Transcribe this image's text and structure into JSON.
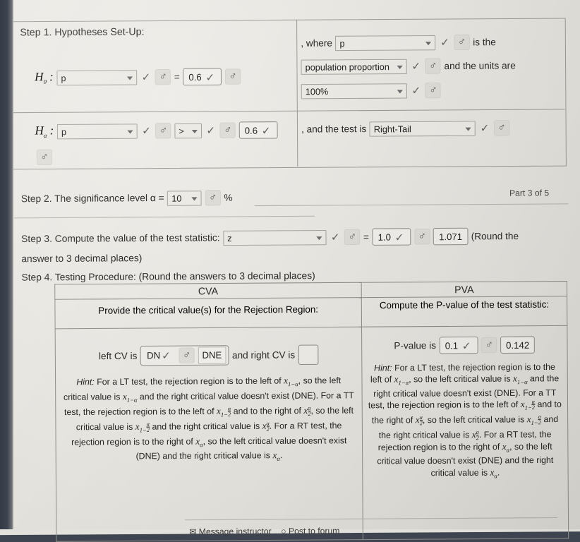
{
  "part_label": "Part 3 of 5",
  "step1": {
    "heading": "Step 1. Hypotheses Set-Up:",
    "h0_label": "H₀ :",
    "h0_param": "p",
    "h0_operator": "=",
    "h0_value": "0.6",
    "ha_label": "Hₐ :",
    "ha_param": "p",
    "ha_operator": ">",
    "ha_value": "0.6",
    "where_text": ", where",
    "where_param": "p",
    "is_the_text": "is the",
    "units_select": "population proportion",
    "and_units_text": "and the units are",
    "units_value": "100%",
    "test_is_text": ", and the test is",
    "test_type": "Right-Tail"
  },
  "step2": {
    "text_before": "Step 2. The significance level α =",
    "alpha_value": "10",
    "percent": "%"
  },
  "step3": {
    "text_before": "Step 3. Compute the value of the test statistic:",
    "statistic_select": "z",
    "equals": "=",
    "df_value": "1.0",
    "answer": "1.071",
    "round_note": "(Round the",
    "round_note2": "answer to 3 decimal places)"
  },
  "step4": {
    "heading": "Step 4. Testing Procedure: (Round the answers to 3 decimal places)",
    "cva": {
      "col_header": "CVA",
      "subheader": "Provide the critical value(s) for the Rejection Region:",
      "left_cv_label": "left CV is",
      "left_cv_select": "DN",
      "left_cv_value": "DNE",
      "right_cv_label": "and right CV is",
      "right_cv_value": "",
      "hint_label": "Hint:",
      "hint_line1": "For a LT test, the rejection region is to the left of",
      "hint_line2": "so the left critical value is",
      "hint_line3": "and the right critical value",
      "hint_line4": "doesn't exist (DNE). For a TT test, the rejection region is to",
      "hint_line5": "the left of",
      "hint_line6": "and to the right of",
      "hint_line7": ", so the left critical",
      "hint_line8": "value is",
      "hint_line9": "and the right critical value is",
      "hint_line10": ". For a RT test,",
      "hint_line11": "the rejection region is to the right of",
      "hint_line12": ", so the left critical",
      "hint_line13": "value doesn't exist (DNE) and the right critical value is",
      "hint_line14": "."
    },
    "pva": {
      "col_header": "PVA",
      "subheader": "Compute the P-value of the test statistic:",
      "pvalue_label": "P-value is",
      "pvalue_select": "0.1",
      "pvalue_answer": "0.142",
      "hint_label": "Hint:",
      "hint_line1": "For a LT test, the rejection region",
      "hint_line2": "is to the left of",
      "hint_line3": "so the left critical",
      "hint_line4": "value is",
      "hint_line5": "and the right critical value",
      "hint_line6": "doesn't exist (DNE). For a TT test, the",
      "hint_line7": "rejection region is to the left of",
      "hint_line8": "and to the right of",
      "hint_line9": ", so the left",
      "hint_line10": "critical value is",
      "hint_line11": "and the right",
      "hint_line12": "critical value is",
      "hint_line13": ". For a RT test, the",
      "hint_line14": "rejection region is to the right of",
      "hint_line15": ", so",
      "hint_line16": "the left critical value doesn't exist (DNE)",
      "hint_line17": "and the right critical value is",
      "hint_line18": "."
    }
  },
  "footer": {
    "message_instructor": "Message instructor",
    "post_to_forum": "Post to forum"
  },
  "colors": {
    "paper": "#e9e7e2",
    "border": "#8f8f8a",
    "text": "#2b2b2b",
    "check": "#63625d"
  }
}
